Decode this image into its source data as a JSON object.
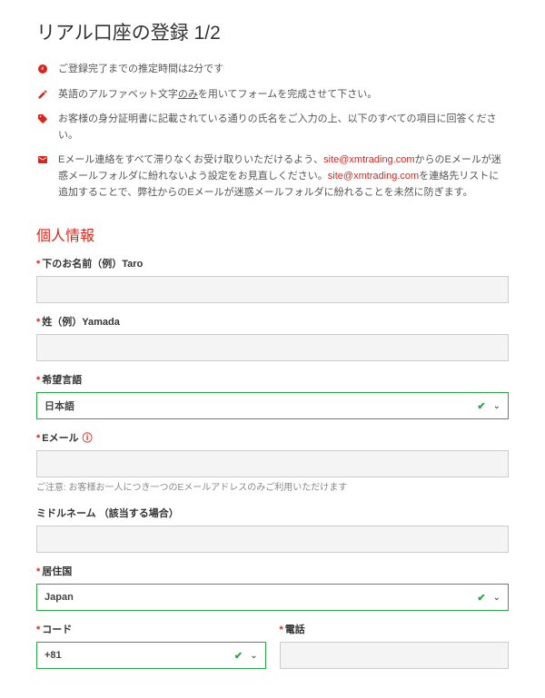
{
  "title": "リアル口座の登録 1/2",
  "notices": [
    {
      "icon": "clock",
      "text_before": "ご登録完了までの推定時間は2分です"
    },
    {
      "icon": "pencil",
      "text_before": "英語のアルファベット文字",
      "underlined": "のみ",
      "text_after": "を用いてフォームを完成させて下さい。"
    },
    {
      "icon": "tag",
      "text_before": "お客様の身分証明書に記載されている通りの氏名をご入力の上、以下のすべての項目に回答ください。"
    },
    {
      "icon": "mail",
      "text_before": "Eメール連絡をすべて滞りなくお受け取りいただけるよう、",
      "link1": "site@xmtrading.com",
      "mid1": "からのEメールが迷惑メールフォルダに紛れないよう設定をお見直しください。",
      "link2": "site@xmtrading.com",
      "mid2": "を連絡先リストに追加することで、弊社からのEメールが迷惑メールフォルダに紛れることを未然に防ぎます。"
    }
  ],
  "section_header": "個人情報",
  "left": {
    "first_name_label": "下のお名前（例）Taro",
    "last_name_label": "姓（例）Yamada",
    "language_label": "希望言語",
    "language_value": "日本語",
    "email_label": "Eメール",
    "email_hint": "ご注意: お客様お一人につき一つのEメールアドレスのみご利用いただけます"
  },
  "right": {
    "middle_name_label": "ミドルネーム （該当する場合）",
    "country_label": "居住国",
    "country_value": "Japan",
    "code_label": "コード",
    "code_value": "+81",
    "phone_label": "電話"
  },
  "required_mark": "*"
}
